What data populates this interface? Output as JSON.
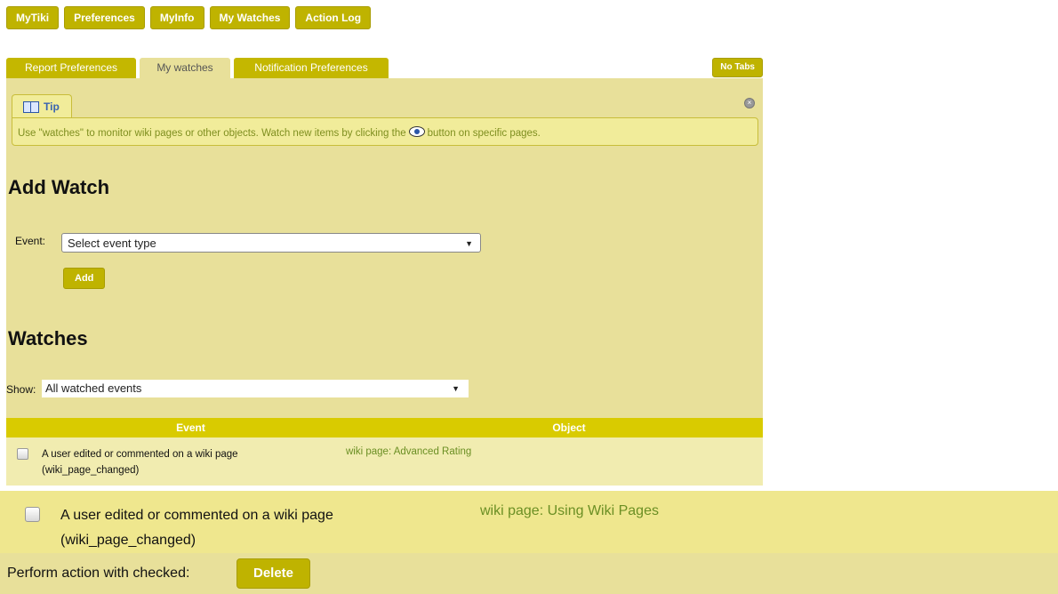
{
  "topnav": [
    "MyTiki",
    "Preferences",
    "MyInfo",
    "My Watches",
    "Action Log"
  ],
  "tabs": [
    "Report Preferences",
    "My watches",
    "Notification Preferences"
  ],
  "no_tabs": "No Tabs",
  "tip": {
    "label": "Tip",
    "text_before": "Use \"watches\" to monitor wiki pages or other objects. Watch new items by clicking the",
    "text_after": "button on specific pages.",
    "icons": {
      "label_icon": "book-icon",
      "inline_icon": "eye-icon",
      "close_icon": "close-icon"
    }
  },
  "add_watch": {
    "heading": "Add Watch",
    "event_label": "Event:",
    "event_select": "Select event type",
    "add_button": "Add"
  },
  "watches": {
    "heading": "Watches",
    "show_label": "Show:",
    "show_select": "All watched events",
    "columns": [
      "Event",
      "Object"
    ],
    "rows": [
      {
        "event": "A user edited or commented on a wiki page",
        "code": "(wiki_page_changed)",
        "object": "wiki page: Advanced Rating"
      },
      {
        "event": "A user edited or commented on a wiki page",
        "code": "(wiki_page_changed)",
        "object": "wiki page: Using Wiki Pages"
      }
    ],
    "perform_label": "Perform action with checked:",
    "delete_button": "Delete"
  },
  "colors": {
    "accent": "#bfb300",
    "panel": "#e8e09a",
    "table_header": "#d9cb00",
    "link": "#6b8f24"
  }
}
